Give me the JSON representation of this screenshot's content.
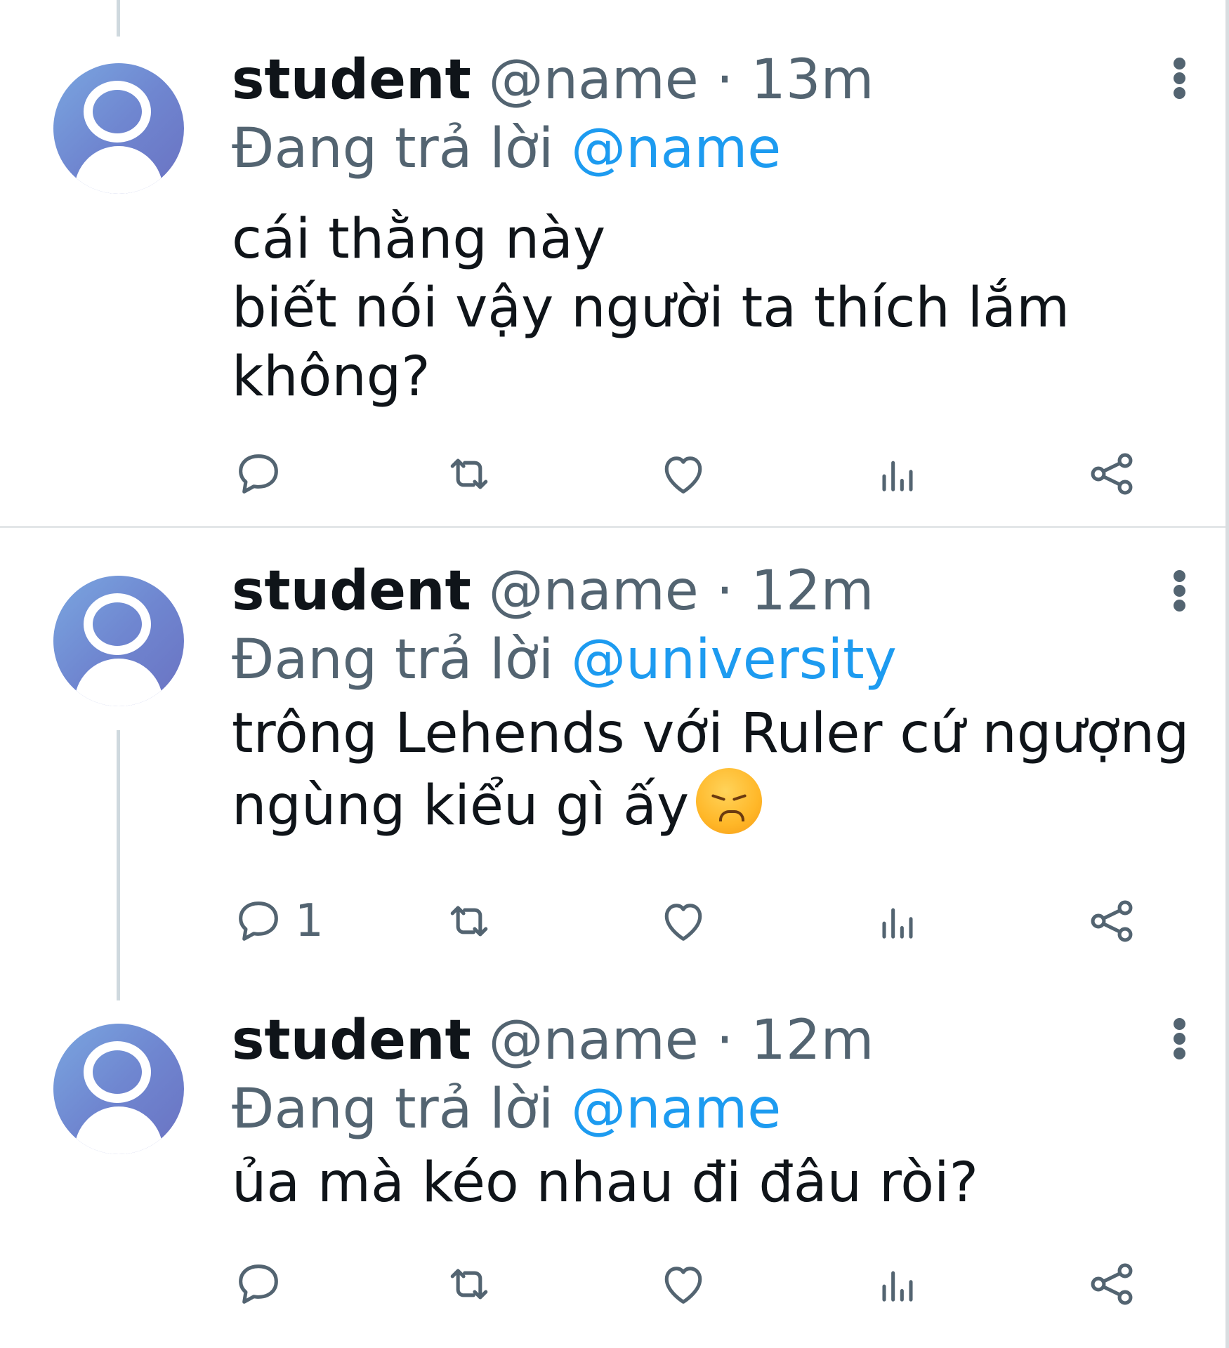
{
  "tweets": [
    {
      "author": "student",
      "handle": "@name",
      "separator": "·",
      "time": "13m",
      "reply_prefix": "Đang trả lời",
      "reply_to": "@name",
      "text": "cái thằng này\nbiết nói vậy người ta thích lắm\nkhông?",
      "reply_count": ""
    },
    {
      "author": "student",
      "handle": "@name",
      "separator": "·",
      "time": "12m",
      "reply_prefix": "Đang trả lời",
      "reply_to": "@university",
      "text": "trông Lehends với Ruler cứ ngượng\nngùng kiểu gì ấy",
      "emoji": "disappointed-face",
      "reply_count": "1"
    },
    {
      "author": "student",
      "handle": "@name",
      "separator": "·",
      "time": "12m",
      "reply_prefix": "Đang trả lời",
      "reply_to": "@name",
      "text": "ủa mà kéo nhau đi đâu ròi?",
      "reply_count": ""
    }
  ],
  "icons": {
    "reply": "speech-bubble-icon",
    "retweet": "retweet-icon",
    "like": "heart-icon",
    "views": "bar-chart-icon",
    "share": "share-icon",
    "more": "more-vertical-icon"
  },
  "colors": {
    "name": "#0f1419",
    "secondary": "#536471",
    "mention": "#1d9bf0",
    "divider": "#e3e6e8",
    "avatar": "#6f86d0"
  }
}
